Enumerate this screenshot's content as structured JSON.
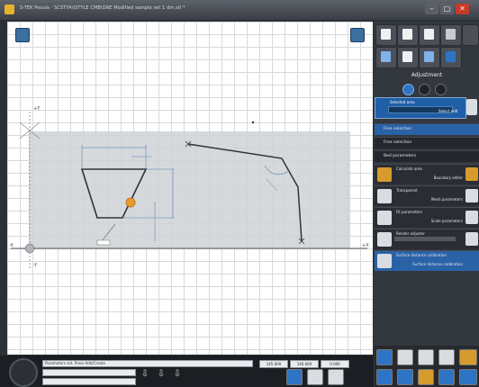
{
  "window": {
    "title": "S-TEK Pesula · SCSTYA\\ISTYLE CMB\\ORE Modified sample set 1 dm.stl *",
    "minimize": "–",
    "maximize": "□",
    "close": "✕"
  },
  "canvas": {
    "axis_labels": {
      "y_pos": "+Y",
      "x_neg": "-X",
      "x_pos": "+X",
      "y_neg": "-Y"
    }
  },
  "right_panel": {
    "section_title": "Adjustment",
    "selection": {
      "label": "Selected area",
      "value": "Select edit"
    },
    "list_items": [
      {
        "label": "Free selection",
        "active": true
      },
      {
        "label": "Free selection",
        "active": false
      },
      {
        "label": "Bed parameters",
        "active": false
      }
    ],
    "tools": [
      {
        "label": "Calculate area",
        "sub": "Boundary editor",
        "icon": "orange"
      },
      {
        "label": "Transparent",
        "sub": "Mesh parameters",
        "icon": "white"
      },
      {
        "label": "Fit parameters",
        "sub": "Scale parameters",
        "icon": "white"
      },
      {
        "label": "Render adjuster",
        "sub": "",
        "icon": "white"
      },
      {
        "label": "Surface distance calibration",
        "sub": "Surface distance calibration",
        "icon": "white"
      }
    ]
  },
  "bottom": {
    "status_line": "Parameters set. Press Add/Create",
    "field2": "",
    "field3": "",
    "coords": [
      "145.000",
      "140.000",
      "0.000"
    ]
  },
  "colors": {
    "accent": "#2e74c4",
    "marker": "#e89a2a",
    "canvas_bg": "#ffffff",
    "shaded": "#cfd2d5"
  }
}
